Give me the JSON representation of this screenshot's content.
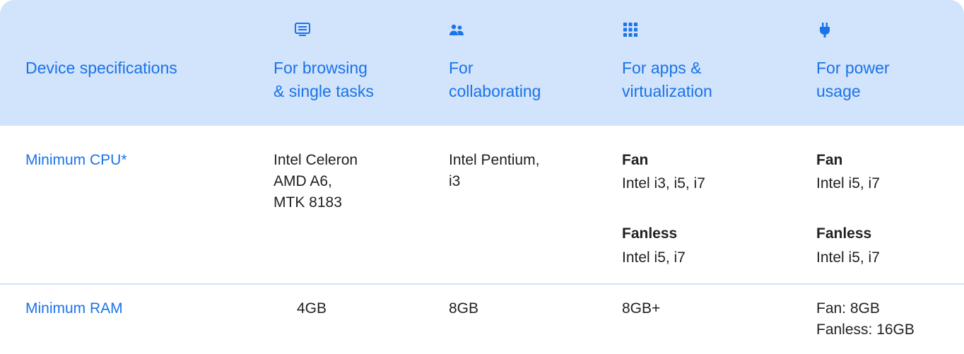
{
  "header": {
    "spec_label": "Device specifications",
    "columns": [
      {
        "icon": "monitor-icon",
        "label": "For browsing\n& single tasks"
      },
      {
        "icon": "people-icon",
        "label": "For\ncollaborating"
      },
      {
        "icon": "apps-grid-icon",
        "label": "For apps &\nvirtualization"
      },
      {
        "icon": "power-plug-icon",
        "label": "For power\nusage"
      }
    ]
  },
  "rows": {
    "cpu": {
      "label": "Minimum CPU*",
      "browsing": "Intel Celeron\nAMD A6,\nMTK 8183",
      "collaborating": "Intel Pentium,\ni3",
      "apps": {
        "fan_title": "Fan",
        "fan_value": "Intel i3, i5, i7",
        "fanless_title": "Fanless",
        "fanless_value": "Intel i5, i7"
      },
      "power": {
        "fan_title": "Fan",
        "fan_value": "Intel i5, i7",
        "fanless_title": "Fanless",
        "fanless_value": "Intel i5, i7"
      }
    },
    "ram": {
      "label": "Minimum RAM",
      "browsing": "4GB",
      "collaborating": "8GB",
      "apps": "8GB+",
      "power": "Fan: 8GB\nFanless: 16GB"
    }
  },
  "colors": {
    "accent": "#1a73e8",
    "header_bg": "#d2e3fc",
    "text": "#202124"
  }
}
